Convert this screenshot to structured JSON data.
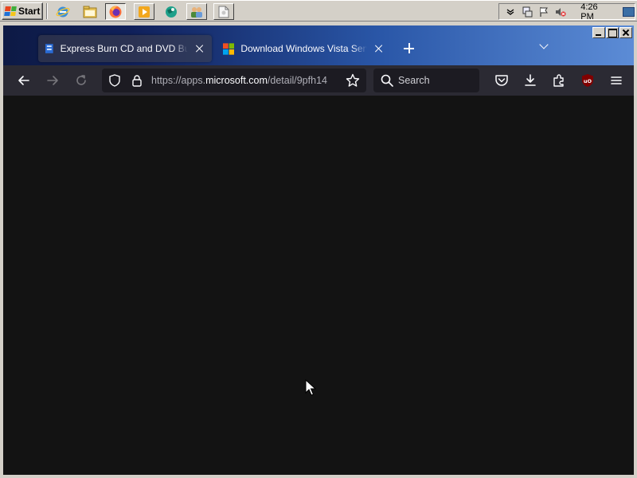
{
  "taskbar": {
    "start_label": "Start",
    "clock": "4:26 PM",
    "quick_launch": [
      {
        "name": "ie-icon",
        "color": "#3b8fd9"
      },
      {
        "name": "explorer-icon",
        "color": "#e8c45a"
      },
      {
        "name": "firefox-icon",
        "color": "#ff7139"
      },
      {
        "name": "media-player-icon",
        "color": "#f2a71d"
      },
      {
        "name": "globe-icon",
        "color": "#1ea08a"
      },
      {
        "name": "users-icon",
        "color": "#6a9bd8"
      },
      {
        "name": "document-icon",
        "color": "#f3f3f3"
      }
    ]
  },
  "browser": {
    "tabs": [
      {
        "title": "Express Burn CD and DVD Burner",
        "active": true,
        "favicon": "express-burn-icon"
      },
      {
        "title": "Download Windows Vista Service Pack",
        "active": false,
        "favicon": "microsoft-icon"
      }
    ],
    "url": {
      "prefix": "https://apps.",
      "host": "microsoft.com",
      "path": "/detail/9pfh14"
    },
    "search_placeholder": "Search"
  },
  "colors": {
    "toolbar": "#2b2a33",
    "field": "#1c1b22",
    "content": "#131313",
    "ublock": "#800000"
  }
}
